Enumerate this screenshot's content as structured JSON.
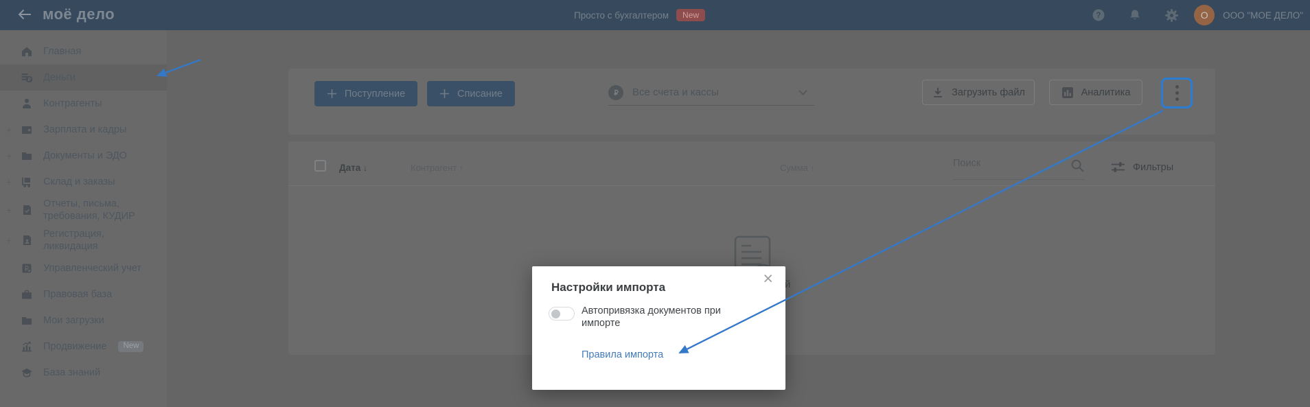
{
  "header": {
    "logo": "моё дело",
    "tagline": "Просто с бухгалтером",
    "tagline_badge": "New",
    "avatar_letter": "O",
    "account_name": "ООО \"МОЕ ДЕЛО\""
  },
  "sidebar": {
    "items": [
      {
        "label": "Главная",
        "icon": "home",
        "expandable": false,
        "selected": false
      },
      {
        "label": "Деньги",
        "icon": "money",
        "expandable": false,
        "selected": true
      },
      {
        "label": "Контрагенты",
        "icon": "contractors",
        "expandable": false,
        "selected": false
      },
      {
        "label": "Зарплата и кадры",
        "icon": "salary",
        "expandable": true,
        "selected": false
      },
      {
        "label": "Документы и ЭДО",
        "icon": "documents",
        "expandable": true,
        "selected": false
      },
      {
        "label": "Склад и заказы",
        "icon": "warehouse",
        "expandable": true,
        "selected": false
      },
      {
        "label": "Отчеты, письма, требования, КУДИР",
        "icon": "reports",
        "expandable": true,
        "selected": false
      },
      {
        "label": "Регистрация, ликвидация",
        "icon": "registration",
        "expandable": true,
        "selected": false
      },
      {
        "label": "Управленческий учет",
        "icon": "management",
        "expandable": false,
        "selected": false
      },
      {
        "label": "Правовая база",
        "icon": "legal",
        "expandable": false,
        "selected": false
      },
      {
        "label": "Мои загрузки",
        "icon": "downloads",
        "expandable": false,
        "selected": false
      },
      {
        "label": "Продвижение",
        "icon": "promotion",
        "expandable": false,
        "selected": false,
        "badge": "New"
      },
      {
        "label": "База знаний",
        "icon": "knowledge",
        "expandable": false,
        "selected": false
      }
    ]
  },
  "toolbar": {
    "add_income_label": "Поступление",
    "add_expense_label": "Списание",
    "accounts_filter_value": "Все счета и кассы",
    "upload_file_label": "Загрузить файл",
    "analytics_label": "Аналитика"
  },
  "table": {
    "columns": [
      {
        "label": "Дата",
        "sort": "desc",
        "arrow": "↓"
      },
      {
        "label": "Контрагент",
        "sort": "asc",
        "arrow": "↑"
      },
      {
        "label": "Сумма",
        "sort": "asc",
        "arrow": "↑"
      }
    ],
    "search_placeholder": "Поиск",
    "filters_label": "Фильтры",
    "empty_state_visible_fragment": "й"
  },
  "modal": {
    "title": "Настройки импорта",
    "close_glyph": "×",
    "toggle_label": "Автопривязка документов при импорте",
    "toggle_state": "off",
    "link_label": "Правила импорта"
  },
  "colors": {
    "header_bg": "#36495D",
    "new_badge_bg": "#8E4D4C",
    "primary_button_bg": "#3A5066",
    "highlight_border_blue": "#2B7CD3",
    "annotation_arrow_blue": "#3478C8",
    "modal_link_blue": "#427BBB",
    "dim_overlay_tone": "#656565"
  }
}
